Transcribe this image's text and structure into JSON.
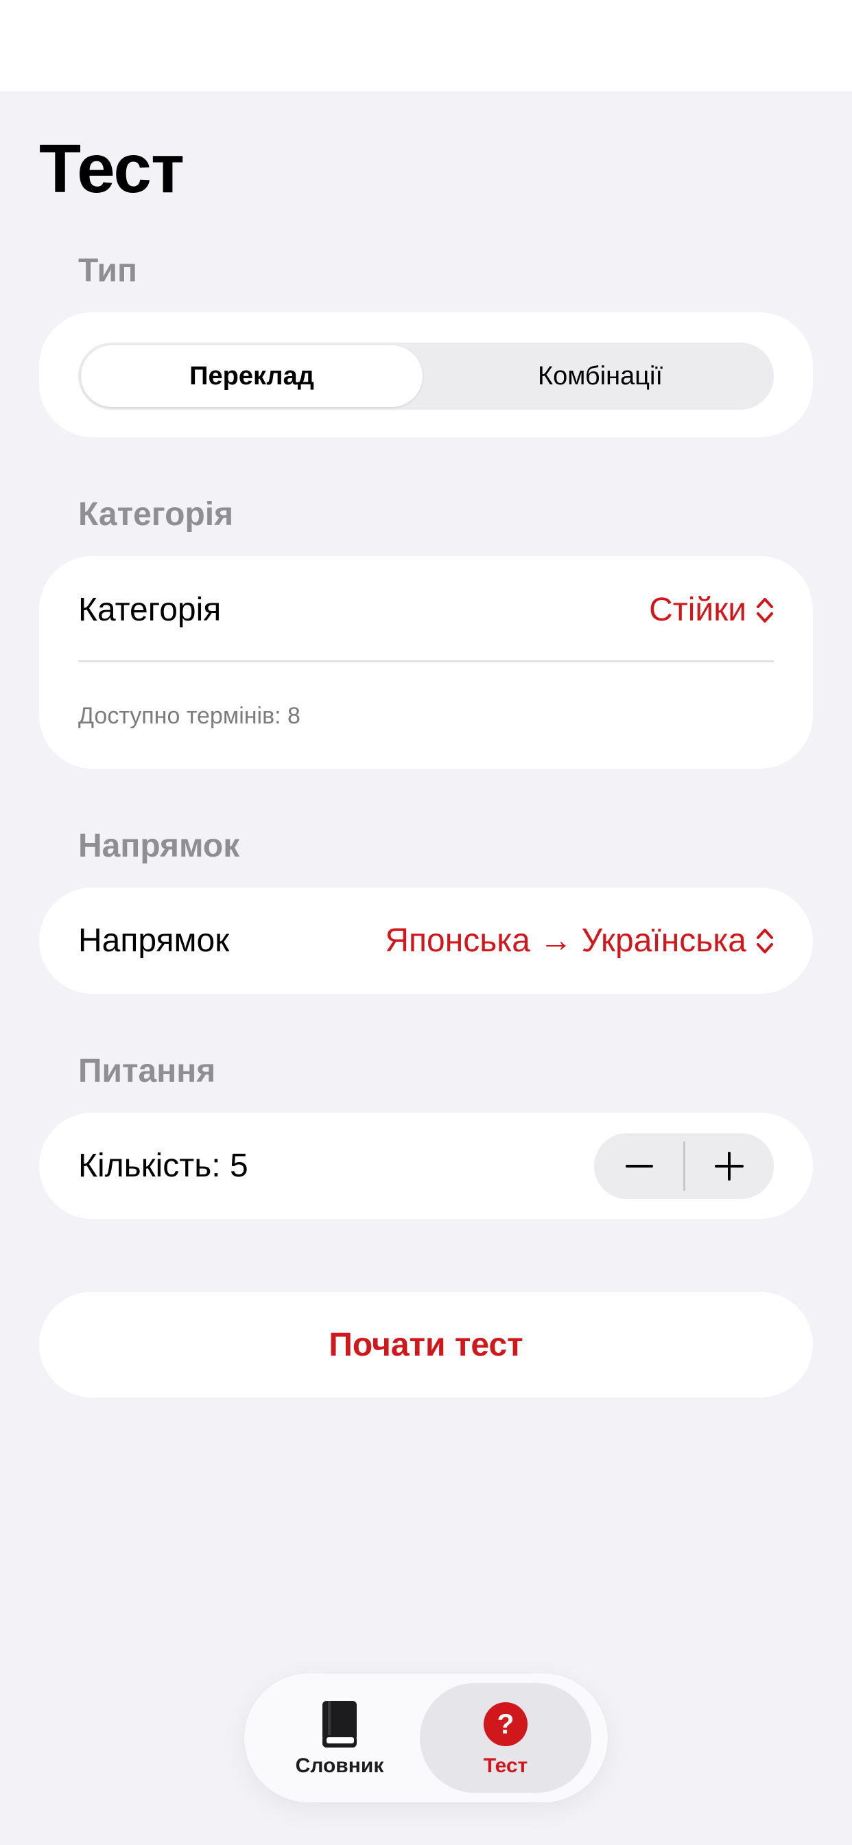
{
  "colors": {
    "accent": "#d0171c",
    "background": "#f2f2f7",
    "card": "#ffffff",
    "secondary_text": "#8e8e93"
  },
  "page": {
    "title": "Тест"
  },
  "type_section": {
    "header": "Тип",
    "segments": [
      {
        "label": "Переклад",
        "selected": true
      },
      {
        "label": "Комбінації",
        "selected": false
      }
    ]
  },
  "category_section": {
    "header": "Категорія",
    "row_label": "Категорія",
    "value": "Стійки",
    "footnote": "Доступно термінів: 8"
  },
  "direction_section": {
    "header": "Напрямок",
    "row_label": "Напрямок",
    "value": "Японська → Українська"
  },
  "questions_section": {
    "header": "Питання",
    "count_label": "Кількість: 5",
    "count": 5
  },
  "start_button": {
    "label": "Почати тест"
  },
  "tabbar": {
    "tabs": [
      {
        "label": "Словник",
        "icon": "book-icon",
        "selected": false
      },
      {
        "label": "Тест",
        "icon": "question-circle-icon",
        "selected": true
      }
    ]
  }
}
